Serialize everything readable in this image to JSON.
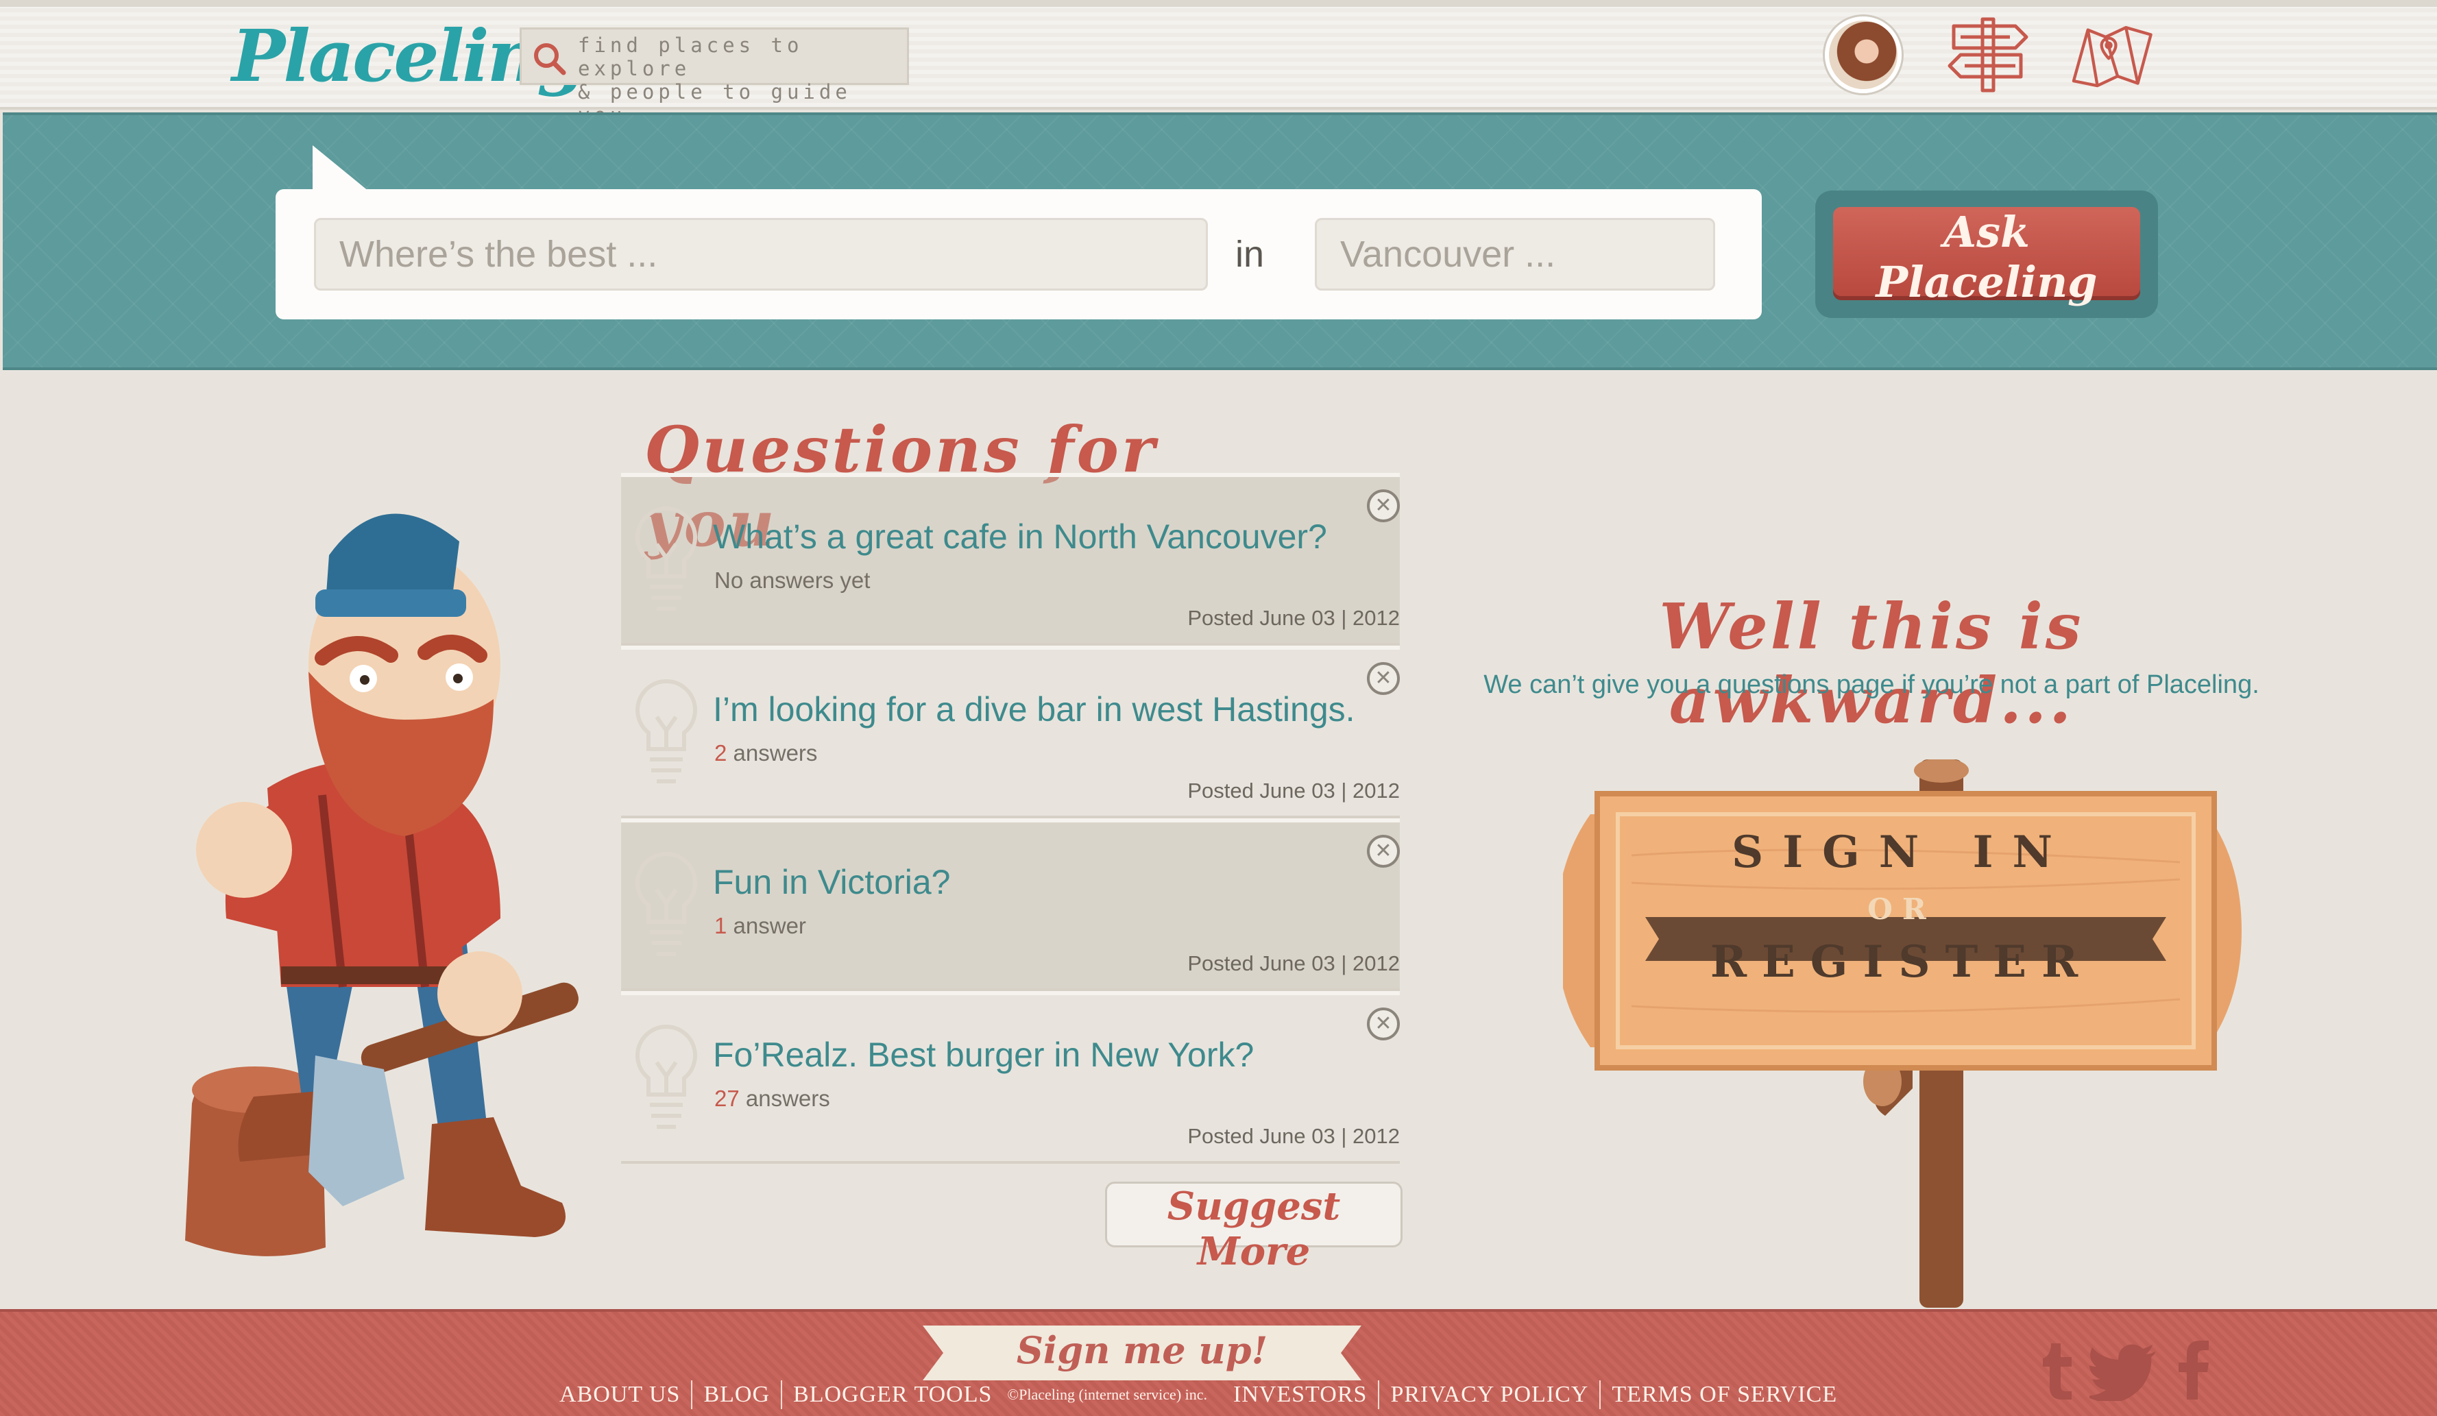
{
  "header": {
    "logo": "Placeling",
    "tagline_line1": "find places to explore",
    "tagline_line2": "& people to guide you"
  },
  "search": {
    "what_placeholder": "Where’s the best ...",
    "in_label": "in",
    "where_placeholder": "Vancouver ...",
    "ask_button": "Ask Placeling"
  },
  "questions": {
    "title": "Questions for you",
    "items": [
      {
        "text": "What’s a great cafe in North Vancouver?",
        "count": "",
        "answers": "No answers yet",
        "date": "Posted June 03 | 2012"
      },
      {
        "text": "I’m looking for a dive bar in west Hastings.",
        "count": "2",
        "answers": " answers",
        "date": "Posted June 03 | 2012"
      },
      {
        "text": "Fun in Victoria?",
        "count": "1",
        "answers": " answer",
        "date": "Posted June 03 | 2012"
      },
      {
        "text": "Fo’Realz. Best burger in New York?",
        "count": "27",
        "answers": " answers",
        "date": "Posted June 03 | 2012"
      }
    ],
    "suggest_button": "Suggest More"
  },
  "awkward": {
    "title": "Well this is awkward...",
    "subtitle": "We can’t give you a questions page if you’re not a part of Placeling."
  },
  "sign": {
    "line1": "SIGN IN",
    "line2": "OR",
    "line3": "REGISTER"
  },
  "footer": {
    "signup": "Sign me up!",
    "links": [
      "ABOUT US",
      "BLOG",
      "BLOGGER TOOLS",
      "INVESTORS",
      "PRIVACY POLICY",
      "TERMS OF SERVICE"
    ],
    "copyright": "©Placeling (internet service) inc."
  },
  "colors": {
    "teal": "#5e9b9c",
    "brand_red": "#c7594d",
    "text_teal": "#3e8a8d",
    "background": "#e8e4dd"
  },
  "icons": [
    "search-icon",
    "signpost-icon",
    "map-icon",
    "lightbulb-icon",
    "close-icon",
    "tumblr-icon",
    "twitter-icon",
    "facebook-icon"
  ]
}
